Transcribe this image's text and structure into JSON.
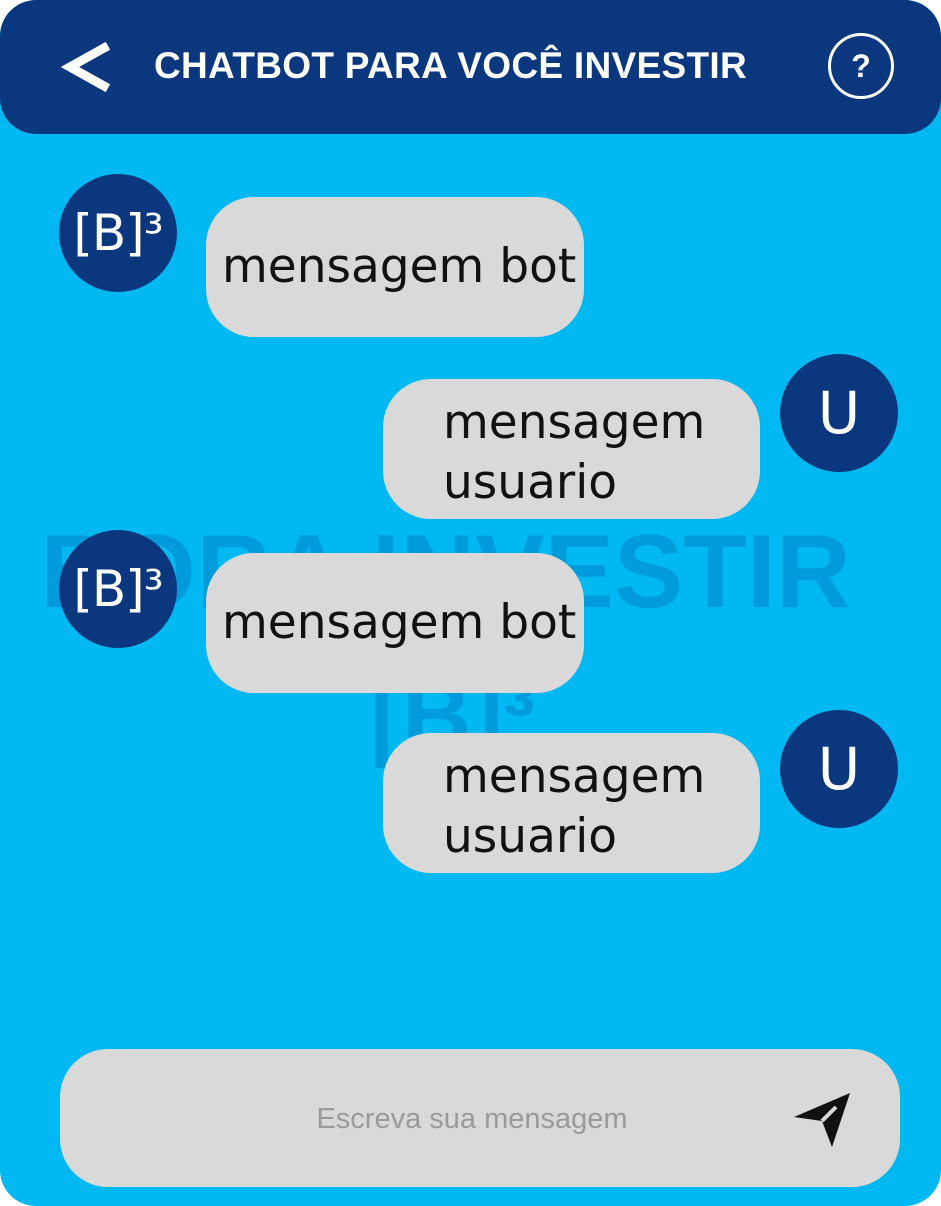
{
  "header": {
    "title": "CHATBOT PARA VOCÊ INVESTIR",
    "back_icon": "chevron-left-icon",
    "help_label": "?"
  },
  "background_watermark": {
    "text": "BORA INVESTIR",
    "logo": "[B]³"
  },
  "messages": [
    {
      "sender": "bot",
      "avatar": "[B]³",
      "text": "mensagem bot"
    },
    {
      "sender": "user",
      "avatar": "U",
      "text": "mensagem usuario"
    },
    {
      "sender": "bot",
      "avatar": "[B]³",
      "text": "mensagem bot"
    },
    {
      "sender": "user",
      "avatar": "U",
      "text": "mensagem usuario"
    }
  ],
  "composer": {
    "placeholder": "Escreva sua mensagem",
    "send_icon": "send-icon"
  },
  "colors": {
    "background": "#00b9f2",
    "header": "#0a377e",
    "avatar": "#0a377e",
    "bubble": "#d9d9d9",
    "watermark": "#0096d6"
  }
}
